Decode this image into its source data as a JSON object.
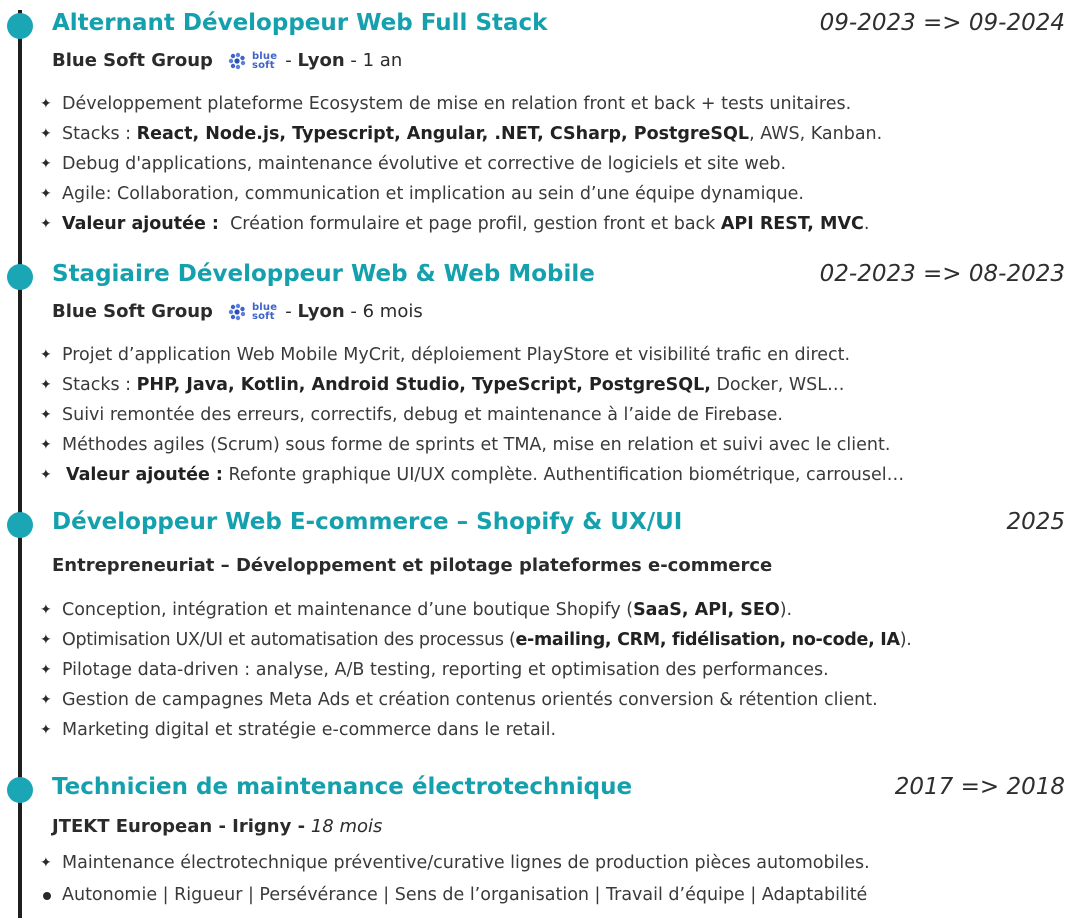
{
  "experiences": [
    {
      "title": "Alternant Développeur Web Full Stack",
      "dates": "09-2023 => 09-2024",
      "company": "Blue Soft Group",
      "logo_text": [
        "blue",
        "soft"
      ],
      "sep1": "-",
      "location": "Lyon",
      "sep2": "-",
      "duration": "1 an",
      "bullets": [
        {
          "plain": "Développement plateforme Ecosystem de mise en relation front et back + tests unitaires."
        },
        {
          "pre": "Stacks : ",
          "bold": "React, Node.js, Typescript, Angular, .NET, CSharp, PostgreSQL",
          "post": ", AWS, Kanban."
        },
        {
          "plain": "Debug d'applications, maintenance évolutive et corrective de logiciels et site web."
        },
        {
          "plain": "Agile: Collaboration, communication et implication au sein d’une équipe dynamique."
        },
        {
          "bold1": "Valeur ajoutée :",
          "mid": "  Création formulaire et page profil, gestion front et back ",
          "bold2": "API REST, MVC",
          "post": "."
        }
      ]
    },
    {
      "title": "Stagiaire Développeur Web & Web Mobile",
      "dates": "02-2023 => 08-2023",
      "company": "Blue Soft Group",
      "logo_text": [
        "blue",
        "soft"
      ],
      "sep1": "-",
      "location": "Lyon",
      "sep2": "-",
      "duration": "6 mois",
      "bullets": [
        {
          "plain": "Projet d’application Web Mobile MyCrit, déploiement PlayStore et visibilité trafic en direct."
        },
        {
          "pre": "Stacks : ",
          "bold": "PHP, Java, Kotlin, Android Studio, TypeScript, PostgreSQL,",
          "post": " Docker, WSL…"
        },
        {
          "plain": "Suivi remontée des erreurs, correctifs, debug et maintenance à l’aide de Firebase."
        },
        {
          "plain": "Méthodes agiles (Scrum) sous forme de sprints et TMA, mise en relation et suivi avec le client."
        },
        {
          "bold1": "Valeur ajoutée :",
          "mid": " Refonte graphique UI/UX complète. Authentification biométrique, carrousel…"
        }
      ]
    },
    {
      "title": "Développeur Web E-commerce – Shopify & UX/UI",
      "dates": "2025",
      "company": "Entrepreneuriat – Développement et pilotage plateformes e-commerce",
      "bullets": [
        {
          "pre": "Conception, intégration et maintenance d’une boutique Shopify (",
          "bold": "SaaS, API, SEO",
          "post": ")."
        },
        {
          "pre": "Optimisation UX/UI et automatisation des processus (",
          "bold": "e-mailing, CRM, fidélisation, no-code, IA",
          "post": ")."
        },
        {
          "plain": "Pilotage data-driven : analyse, A/B testing, reporting et optimisation des performances."
        },
        {
          "plain": "Gestion de campagnes Meta Ads et création contenus orientés conversion & rétention client."
        },
        {
          "plain": "Marketing digital et stratégie e-commerce dans le retail."
        }
      ]
    },
    {
      "title": "Technicien de maintenance électrotechnique",
      "dates": "2017 => 2018",
      "company": "JTEKT European - Irigny -",
      "duration": "18 mois",
      "bullets": [
        {
          "plain": "Maintenance électrotechnique préventive/curative lignes de production pièces automobiles."
        }
      ],
      "qualities": "Autonomie | Rigueur | Persévérance | Sens de l’organisation | Travail d’équipe | Adaptabilité"
    }
  ],
  "colors": {
    "accent": "#14a0ad",
    "dot": "#1aa6b5",
    "logo": "#3f63c9"
  },
  "icons": {
    "bullet": "four-pointed-star-icon",
    "logo": "blue-soft-logo",
    "timeline": "timeline-dot"
  }
}
